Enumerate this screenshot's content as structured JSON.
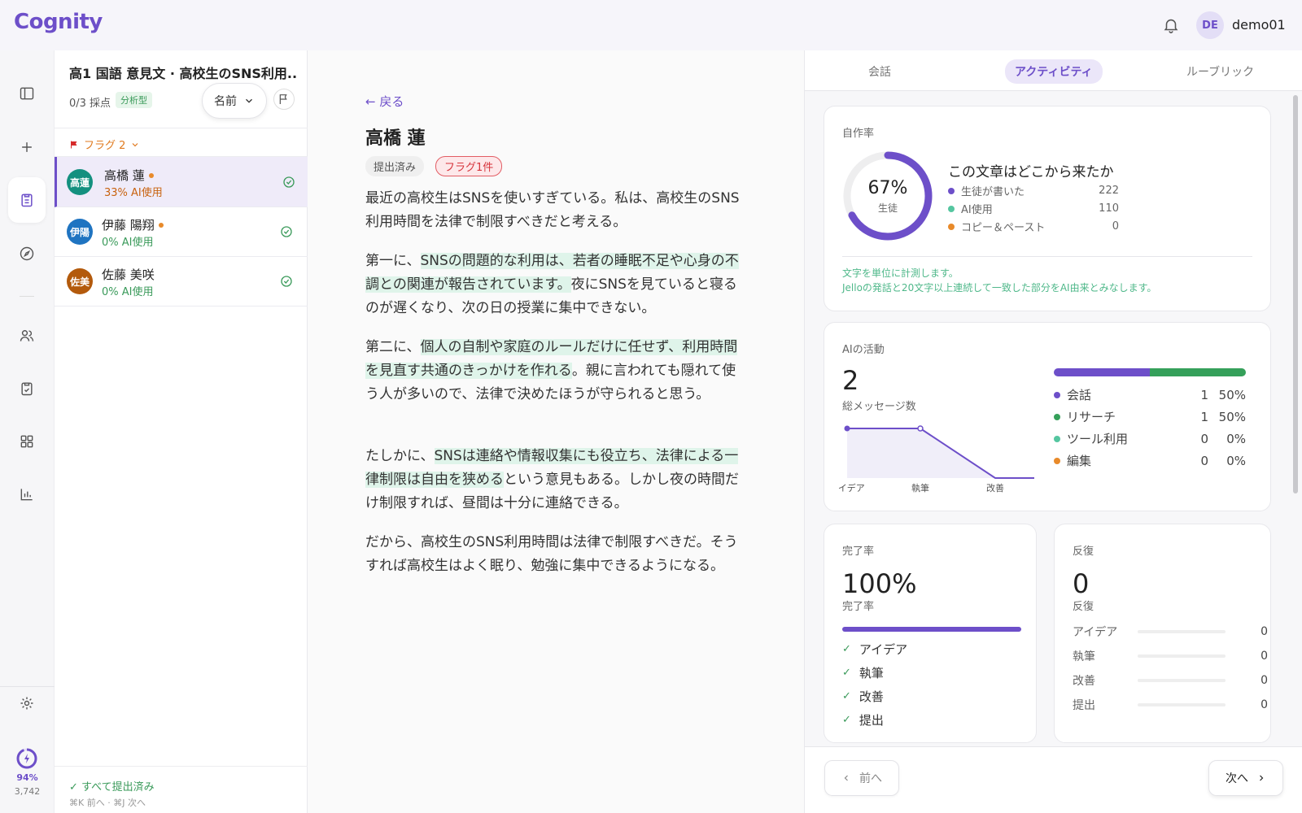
{
  "header": {
    "logo": "Cognity",
    "avatar_initials": "DE",
    "username": "demo01"
  },
  "rail": {
    "credit_percent": "94%",
    "credit_value": "3,742"
  },
  "list": {
    "assignment_title": "高1 国語 意見文 · 高校生のSNS利用...",
    "graded": "0/3 採点",
    "rubric_type": "分析型",
    "sort_label": "名前",
    "flag_filter": "フラグ 2",
    "students": [
      {
        "initials": "高蓮",
        "name": "高橋 蓮",
        "ai": "33% AI使用",
        "color": "#14907f",
        "ai_color": "#c8620f",
        "flagged": true
      },
      {
        "initials": "伊陽",
        "name": "伊藤 陽翔",
        "ai": "0% AI使用",
        "color": "#1f74c1",
        "ai_color": "#3a9a5a",
        "flagged": true
      },
      {
        "initials": "佐美",
        "name": "佐藤 美咲",
        "ai": "0% AI使用",
        "color": "#b35a0c",
        "ai_color": "#3a9a5a",
        "flagged": false
      }
    ],
    "all_submitted": "✓ すべて提出済み",
    "shortcut_hint": "⌘K 前へ · ⌘J 次へ"
  },
  "essay": {
    "back": "← 戻る",
    "student_name": "高橋 蓮",
    "status_tag": "提出済み",
    "flag_tag": "フラグ1件",
    "p1": "最近の高校生はSNSを使いすぎている。私は、高校生のSNS利用時間を法律で制限すべきだと考える。",
    "p2_a": "第一に、",
    "p2_hl": "SNSの問題的な利用は、若者の睡眠不足や心身の不調との関連が報告されています。",
    "p2_b": "夜にSNSを見ていると寝るのが遅くなり、次の日の授業に集中できない。",
    "p3_a": "第二に、",
    "p3_hl": "個人の自制や家庭のルールだけに任せず、利用時間を見直す共通のきっかけを作れる",
    "p3_b": "。親に言われても隠れて使う人が多いので、法律で決めたほうが守られると思う。",
    "p4_a": "たしかに、",
    "p4_hl": "SNSは連絡や情報収集にも役立ち、法律による一律制限は自由を狭める",
    "p4_b": "という意見もある。しかし夜の時間だけ制限すれば、昼間は十分に連絡できる。",
    "p5": "だから、高校生のSNS利用時間は法律で制限すべきだ。そうすれば高校生はよく眠り、勉強に集中できるようになる。"
  },
  "panel": {
    "tabs": [
      "会話",
      "アクティビティ",
      "ルーブリック"
    ],
    "authorship": {
      "label": "自作率",
      "percent_text": "67%",
      "percent_value": 67,
      "ring_sub": "生徒",
      "source_title": "この文章はどこから来たか",
      "sources": [
        {
          "label": "生徒が書いた",
          "value": "222",
          "color": "#6d4fc9"
        },
        {
          "label": "AI使用",
          "value": "110",
          "color": "#55c6a0"
        },
        {
          "label": "コピー＆ペースト",
          "value": "0",
          "color": "#e88a2a"
        }
      ],
      "note1": "文字を単位に計測します。",
      "note2": "Jelloの発話と20文字以上連続して一致した部分をAI由来とみなします。"
    },
    "ai_activity": {
      "label": "AIの活動",
      "total": "2",
      "total_label": "総メッセージ数",
      "spark_labels": [
        "アイデア",
        "執筆",
        "改善"
      ],
      "bar": [
        {
          "pct": 50,
          "color": "#6d4fc9"
        },
        {
          "pct": 50,
          "color": "#35a05a"
        }
      ],
      "rows": [
        {
          "label": "会話",
          "count": "1",
          "pct": "50%",
          "color": "#6d4fc9"
        },
        {
          "label": "リサーチ",
          "count": "1",
          "pct": "50%",
          "color": "#35a05a"
        },
        {
          "label": "ツール利用",
          "count": "0",
          "pct": "0%",
          "color": "#55c6a0"
        },
        {
          "label": "編集",
          "count": "0",
          "pct": "0%",
          "color": "#e88a2a"
        }
      ]
    },
    "completion": {
      "label": "完了率",
      "value": "100%",
      "sub": "完了率",
      "progress": 100,
      "steps": [
        "アイデア",
        "執筆",
        "改善",
        "提出"
      ]
    },
    "iteration": {
      "label": "反復",
      "value": "0",
      "sub": "反復",
      "rows": [
        {
          "label": "アイデア",
          "value": "0"
        },
        {
          "label": "執筆",
          "value": "0"
        },
        {
          "label": "改善",
          "value": "0"
        },
        {
          "label": "提出",
          "value": "0"
        }
      ]
    },
    "prev": "前へ",
    "next": "次へ"
  }
}
